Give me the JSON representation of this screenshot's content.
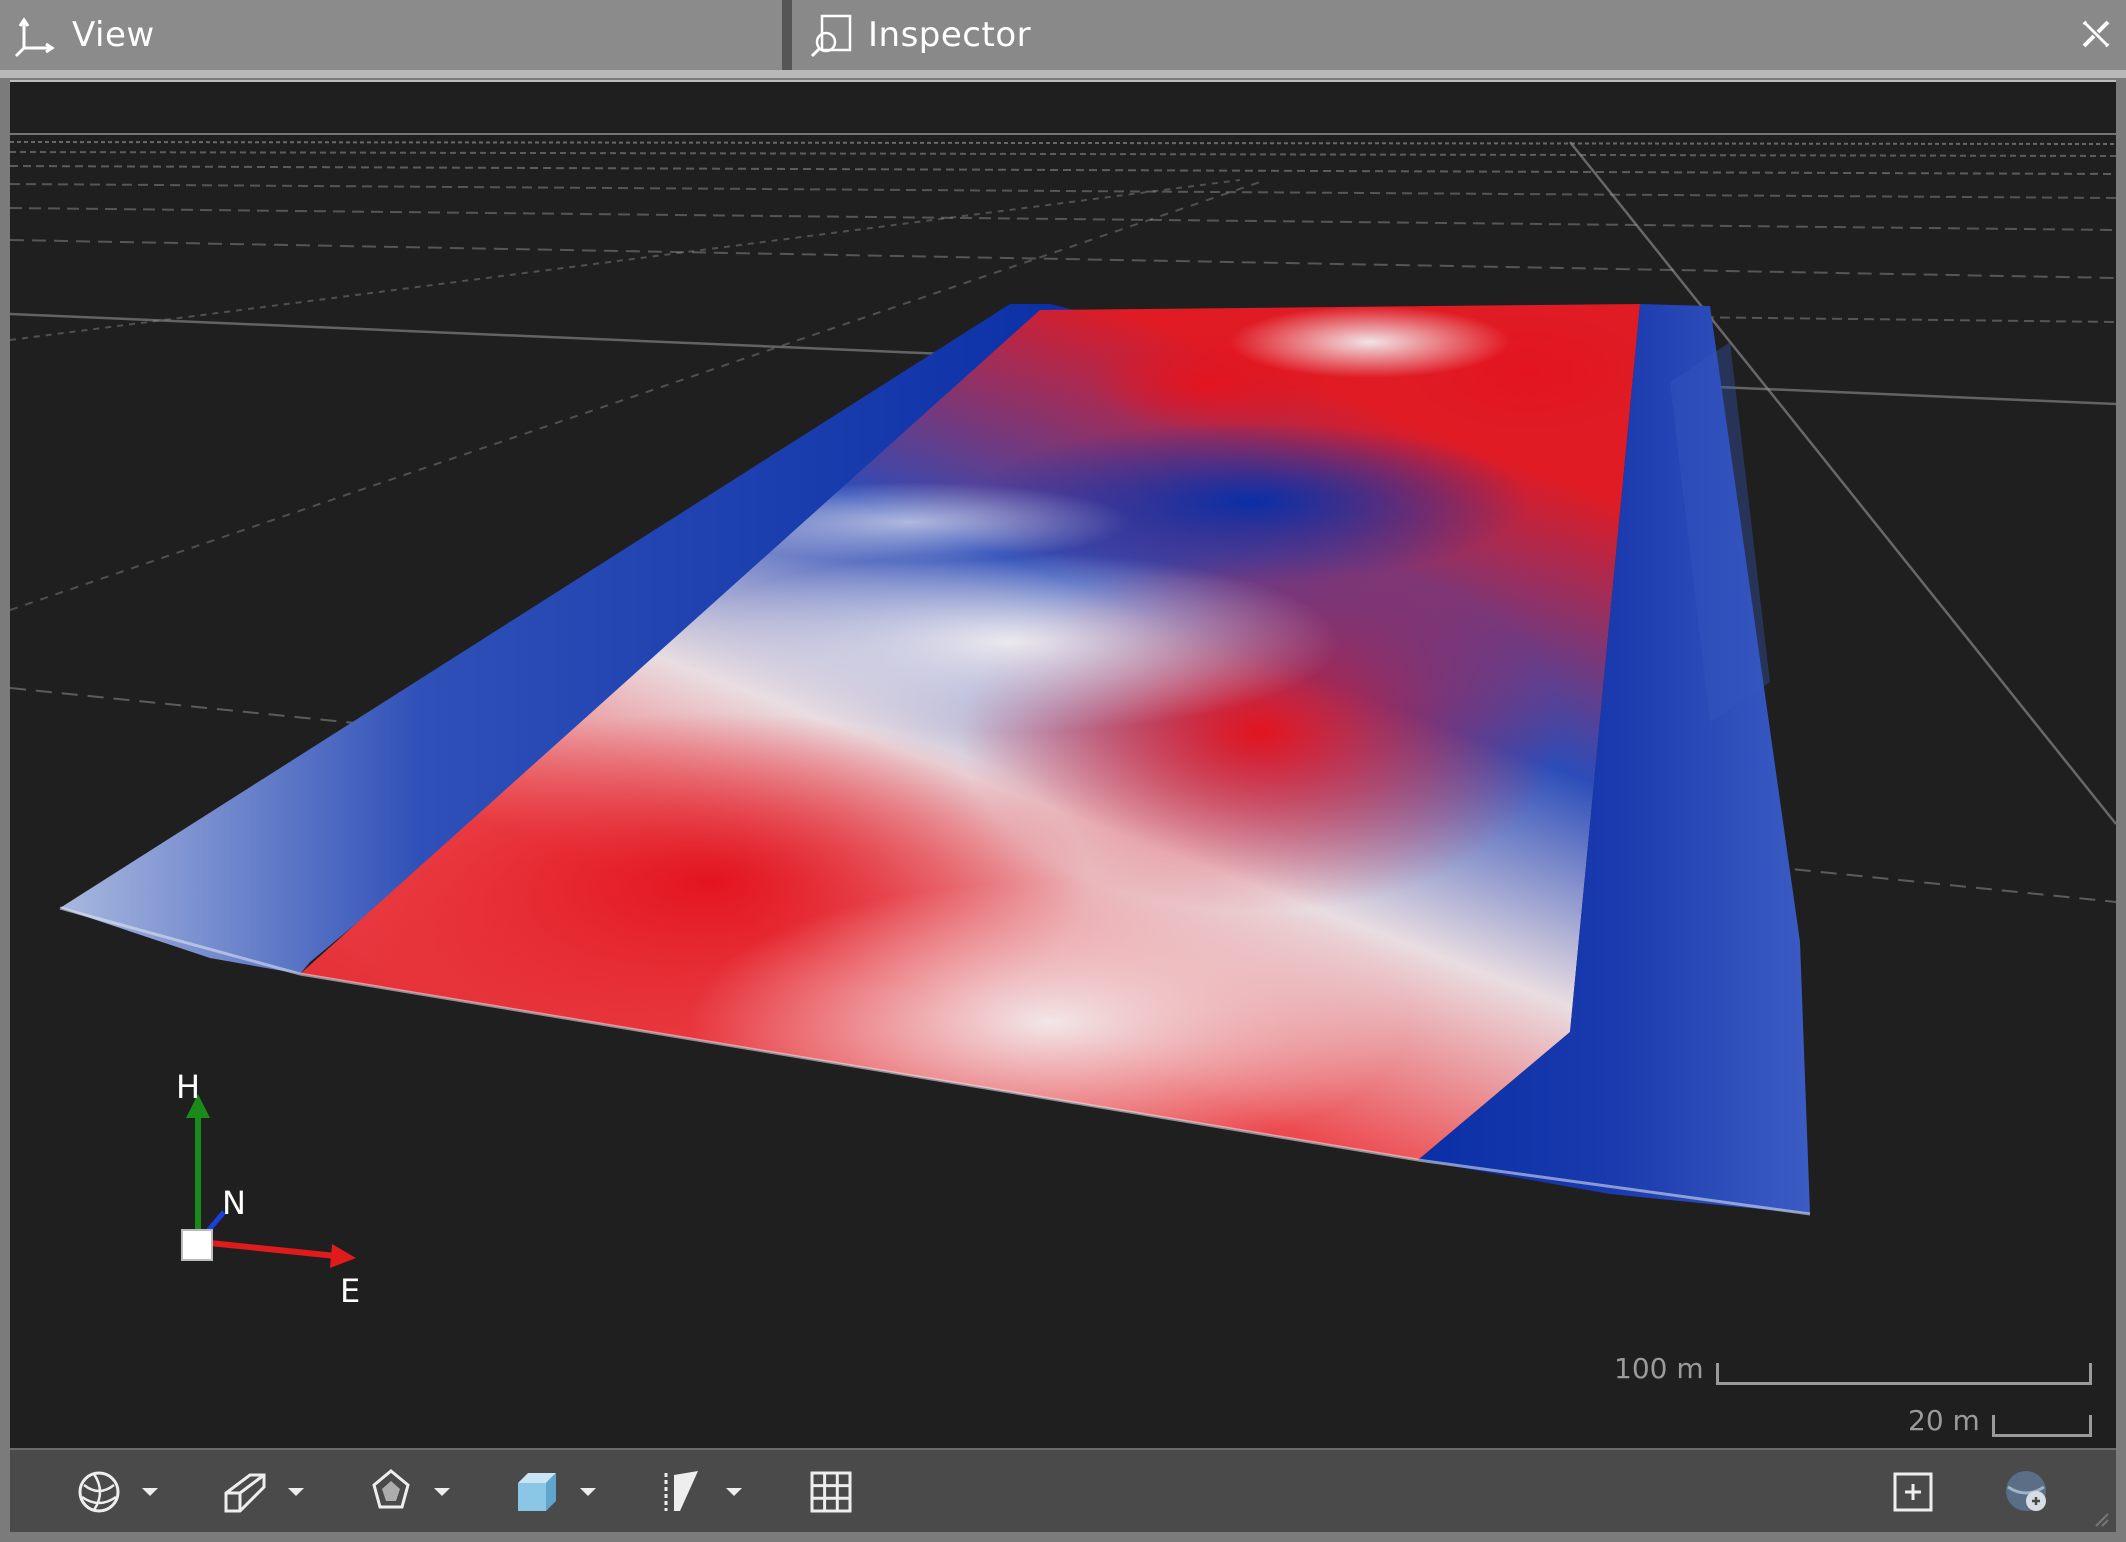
{
  "tabs": {
    "view_label": "View",
    "inspector_label": "Inspector"
  },
  "viewport": {
    "axes": {
      "up_label": "H",
      "north_label": "N",
      "east_label": "E"
    },
    "scale": {
      "large_label": "100 m",
      "small_label": "20 m"
    },
    "colors": {
      "background": "#1f1f1f",
      "high": "#e01b24",
      "mid": "#ecedf2",
      "low": "#0a2fa6"
    }
  },
  "toolbar": {
    "tools": [
      {
        "name": "render-mode-icon",
        "has_dropdown": true
      },
      {
        "name": "draw-tool-icon",
        "has_dropdown": true
      },
      {
        "name": "shading-icon",
        "has_dropdown": true
      },
      {
        "name": "box-view-icon",
        "has_dropdown": true
      },
      {
        "name": "clip-icon",
        "has_dropdown": true
      },
      {
        "name": "grid-icon",
        "has_dropdown": false
      },
      {
        "name": "zoom-extents-icon",
        "has_dropdown": false
      },
      {
        "name": "globe-settings-icon",
        "has_dropdown": false
      }
    ]
  }
}
